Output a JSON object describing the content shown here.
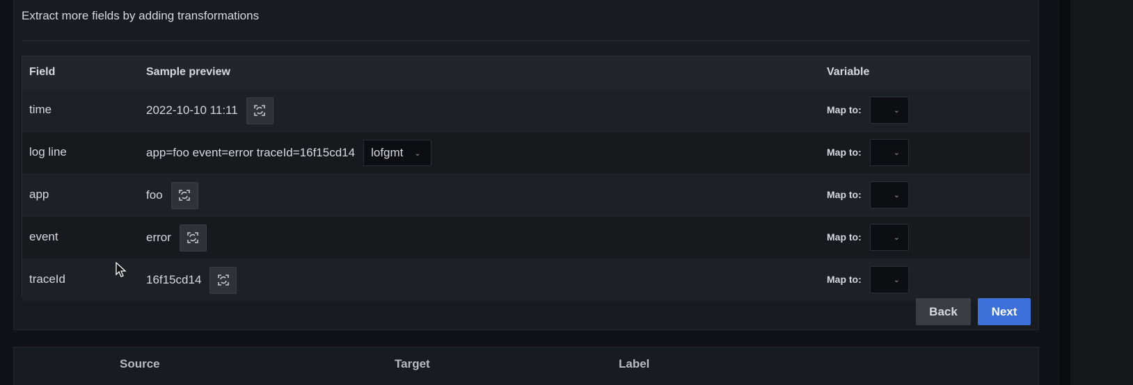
{
  "panel": {
    "title": "Extract more fields by adding transformations"
  },
  "table": {
    "headers": {
      "field": "Field",
      "sample": "Sample preview",
      "variable": "Variable"
    },
    "map_label": "Map to:",
    "rows": [
      {
        "field": "time",
        "sample": "2022-10-10 11:11"
      },
      {
        "field": "log line",
        "sample": "app=foo event=error traceId=16f15cd14",
        "format": "lofgmt"
      },
      {
        "field": "app",
        "sample": "foo"
      },
      {
        "field": "event",
        "sample": "error"
      },
      {
        "field": "traceId",
        "sample": "16f15cd14"
      }
    ]
  },
  "buttons": {
    "back": "Back",
    "next": "Next"
  },
  "bottom_table": {
    "headers": {
      "source": "Source",
      "target": "Target",
      "label": "Label"
    }
  },
  "colors": {
    "primary": "#3d71d9",
    "background": "#111217",
    "panel": "#181b1f"
  },
  "icons": {
    "transform": "transform-icon",
    "chevron": "chevron-down-icon"
  }
}
